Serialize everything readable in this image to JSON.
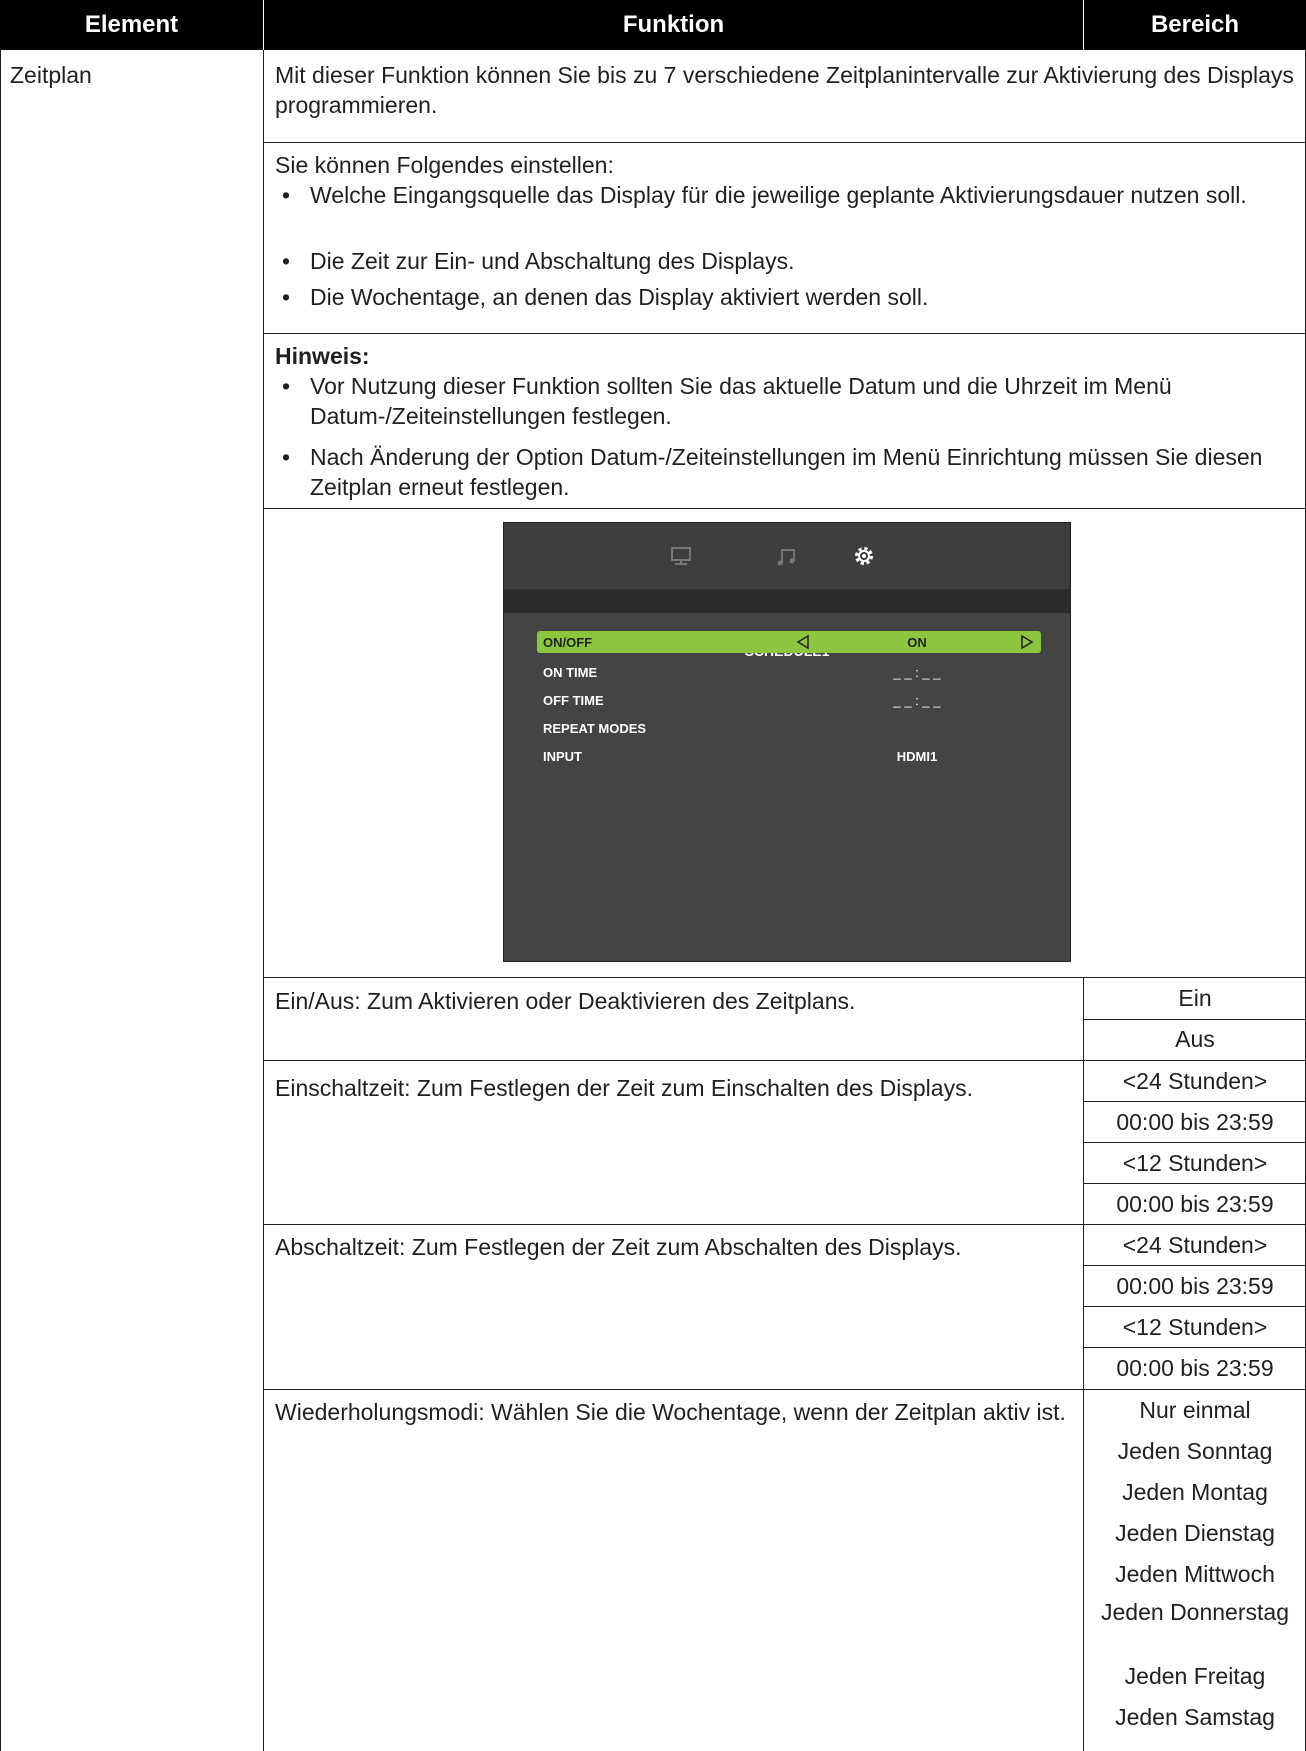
{
  "header": {
    "col_element": "Element",
    "col_funktion": "Funktion",
    "col_bereich": "Bereich"
  },
  "item": {
    "name": "Zeitplan",
    "intro": "Mit dieser Funktion können Sie bis zu 7 verschiedene Zeitplanintervalle zur Aktivierung des Displays programmieren.",
    "settable_heading": "Sie können Folgendes einstellen:",
    "settable": [
      "Welche Eingangsquelle das Display für die jeweilige geplante Aktivierungsdauer nutzen soll.",
      "Die Zeit zur Ein- und Abschaltung des Displays.",
      "Die Wochentage, an denen das Display aktiviert werden soll."
    ],
    "note_heading": "Hinweis:",
    "notes": [
      "Vor Nutzung dieser Funktion sollten Sie das aktuelle Datum und die Uhrzeit im Menü Datum-/Zeiteinstellungen festlegen.",
      "Nach Änderung der Option Datum-/Zeiteinstellungen im Menü Einrichtung müssen Sie diesen Zeitplan erneut festlegen."
    ]
  },
  "osd": {
    "icons": [
      "display-icon",
      "music-icon",
      "settings-icon"
    ],
    "title": "SCHEDULE1",
    "rows": [
      {
        "label": "ON/OFF",
        "value": "ON"
      },
      {
        "label": "ON TIME",
        "value": "_ _  :  _ _"
      },
      {
        "label": "OFF TIME",
        "value": "_ _  :  _ _"
      },
      {
        "label": "REPEAT MODES",
        "value": ""
      },
      {
        "label": "INPUT",
        "value": "HDMI1"
      }
    ],
    "colors": {
      "background": "#444444",
      "highlight": "#8cc63f"
    }
  },
  "options": [
    {
      "description": "Ein/Aus: Zum Aktivieren oder Deaktivieren des Zeitplans.",
      "range": [
        "Ein",
        "Aus"
      ]
    },
    {
      "description": "Einschaltzeit: Zum Festlegen der Zeit zum Einschalten des Displays.",
      "range": [
        "<24 Stunden>",
        "00:00 bis 23:59",
        "<12 Stunden>",
        "00:00 bis 23:59"
      ]
    },
    {
      "description": "Abschaltzeit: Zum Festlegen der Zeit zum Abschalten des Displays.",
      "range": [
        "<24 Stunden>",
        "00:00 bis 23:59",
        "<12 Stunden>",
        "00:00 bis 23:59"
      ]
    },
    {
      "description": "Wiederholungsmodi: Wählen Sie die Wochentage, wenn der Zeitplan aktiv ist.",
      "range": [
        "Nur einmal",
        "Jeden Sonntag",
        "Jeden Montag",
        "Jeden Dienstag",
        "Jeden Mittwoch",
        "Jeden Donnerstag",
        "Jeden Freitag",
        "Jeden Samstag"
      ]
    }
  ]
}
